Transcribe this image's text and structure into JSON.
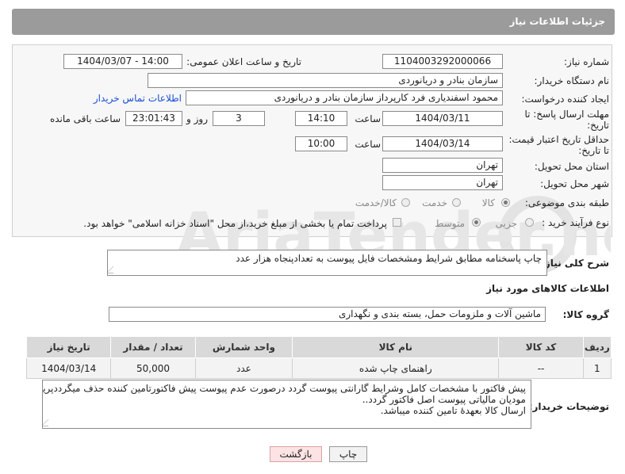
{
  "header": {
    "title": "جزئیات اطلاعات نیاز"
  },
  "fields": {
    "need_number_label": "شماره نیاز:",
    "need_number": "1104003292000066",
    "announce_label": "تاریخ و ساعت اعلان عمومی:",
    "announce_value": "1404/03/07 - 14:00",
    "buyer_org_label": "نام دستگاه خریدار:",
    "buyer_org": "سازمان بنادر و دریانوردی",
    "creator_label": "ایجاد کننده درخواست:",
    "creator": "محمود اسفندیاری فرد کارپرداز سازمان بنادر و دریانوردی",
    "contact_link": "اطلاعات تماس خریدار",
    "reply_deadline_label_1": "مهلت ارسال پاسخ: تا",
    "reply_deadline_label_2": "تاریخ:",
    "reply_date": "1404/03/11",
    "time_label": "ساعت",
    "reply_time": "14:10",
    "days_value": "3",
    "days_label": "روز و",
    "remaining_time": "23:01:43",
    "remaining_label": "ساعت باقی مانده",
    "price_deadline_label_1": "حداقل تاریخ اعتبار قیمت:",
    "price_deadline_label_2": "تا تاریخ:",
    "price_date": "1404/03/14",
    "price_time": "10:00",
    "province_label": "استان محل تحویل:",
    "province": "تهران",
    "city_label": "شهر محل تحویل:",
    "city": "تهران",
    "category_label": "طبقه بندی موضوعی:",
    "category_options": [
      "کالا",
      "خدمت",
      "کالا/خدمت"
    ],
    "process_label": "نوع فرآیند خرید :",
    "process_options": [
      "جزیی",
      "متوسط"
    ],
    "payment_note": "پرداخت تمام یا بخشی از مبلغ خرید،از محل \"اسناد خزانه اسلامی\" خواهد بود."
  },
  "description": {
    "label": "شرح کلی نیاز:",
    "text": "چاپ پاسخنامه مطابق شرایط ومشخصات فایل پیوست به تعدادپنجاه هزار عدد"
  },
  "goods": {
    "section_title": "اطلاعات کالاهای مورد نیاز",
    "group_label": "گروه کالا:",
    "group_value": "ماشین آلات و ملزومات حمل، بسته بندی و نگهداری",
    "columns": [
      "ردیف",
      "کد کالا",
      "نام کالا",
      "واحد شمارش",
      "تعداد / مقدار",
      "تاریخ نیاز"
    ],
    "rows": [
      {
        "row": "1",
        "code": "--",
        "name": "راهنمای چاپ شده",
        "unit": "عدد",
        "qty": "50,000",
        "date": "1404/03/14"
      }
    ]
  },
  "buyer_notes": {
    "label": "توضیحات خریدار:",
    "line1": "پیش فاکتور با مشخصات کامل وشرایط گارانتی پیوست گردد درصورت عدم پیوست پیش فاکتورتامین کننده حذف میگرددپرینت",
    "line2": "مودیان مالیاتی پیوست اصل فاکتور گردد..",
    "line3": "ارسال کالا بعهدهٔ تامین کننده میباشد."
  },
  "buttons": {
    "print": "چاپ",
    "back": "بازگشت"
  },
  "colors": {
    "header_bg": "#9b9b9b",
    "link": "#1a4fd6",
    "watermark": "#e3e3e3",
    "back_btn_bg": "#fde3e3"
  }
}
